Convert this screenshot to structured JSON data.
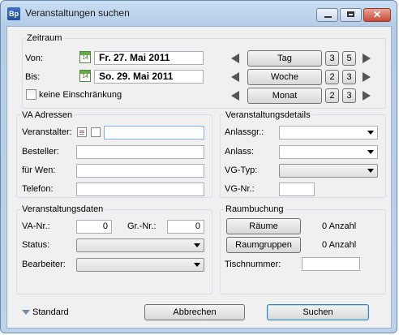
{
  "window": {
    "icon_text": "Bp",
    "title": "Veranstaltungen suchen",
    "minimize_icon": "minimize-icon",
    "maximize_icon": "maximize-icon",
    "close_icon": "close-icon",
    "close_glyph": "✕"
  },
  "zeitraum": {
    "title": "Zeitraum",
    "von_label": "Von:",
    "von_value": "Fr. 27. Mai 2011",
    "bis_label": "Bis:",
    "bis_value": "So. 29. Mai 2011",
    "calendar_day": "14",
    "no_limit_label": "keine Einschränkung",
    "periods": [
      {
        "label": "Tag",
        "a": "3",
        "b": "5"
      },
      {
        "label": "Woche",
        "a": "2",
        "b": "3"
      },
      {
        "label": "Monat",
        "a": "2",
        "b": "3"
      }
    ]
  },
  "adressen": {
    "title": "VA Adressen",
    "veranstalter_label": "Veranstalter:",
    "besteller_label": "Besteller:",
    "fuer_wen_label": "für Wen:",
    "telefon_label": "Telefon:"
  },
  "details": {
    "title": "Veranstaltungsdetails",
    "anlassgr_label": "Anlassgr.:",
    "anlass_label": "Anlass:",
    "vg_typ_label": "VG-Typ:",
    "vg_nr_label": "VG-Nr.:"
  },
  "daten": {
    "title": "Veranstaltungsdaten",
    "va_nr_label": "VA-Nr.:",
    "va_nr_value": "0",
    "gr_nr_label": "Gr.-Nr.:",
    "gr_nr_value": "0",
    "status_label": "Status:",
    "bearbeiter_label": "Bearbeiter:"
  },
  "raum": {
    "title": "Raumbuchung",
    "raeume_button": "Räume",
    "raeume_count": "0 Anzahl",
    "raumgruppen_button": "Raumgruppen",
    "raumgruppen_count": "0 Anzahl",
    "tisch_label": "Tischnummer:"
  },
  "footer": {
    "standard_label": "Standard",
    "cancel_button": "Abbrechen",
    "search_button": "Suchen"
  }
}
